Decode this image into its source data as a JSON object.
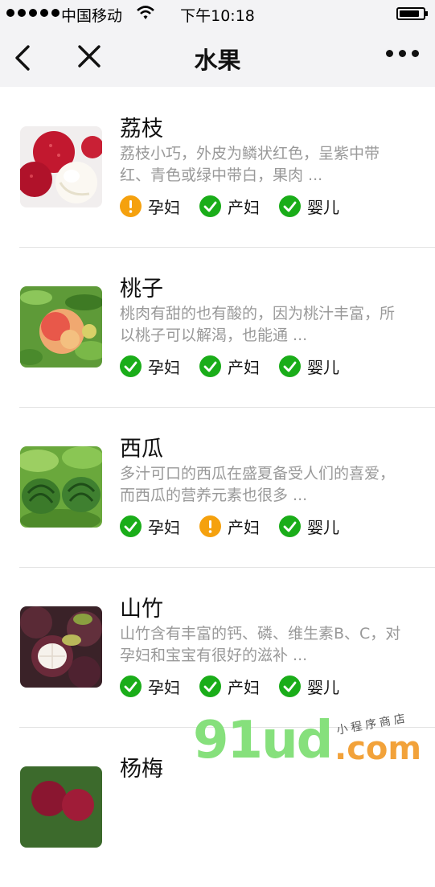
{
  "status_bar": {
    "carrier": "中国移动",
    "time": "下午10:18"
  },
  "nav": {
    "title": "水果",
    "back_icon": "chevron-left-icon",
    "close_icon": "close-icon",
    "more_icon": "more-icon"
  },
  "colors": {
    "ok": "#1aad19",
    "warn": "#f5a10e",
    "description": "#999999"
  },
  "items": [
    {
      "name": "荔枝",
      "description": "荔枝小巧，外皮为鳞状红色，呈紫中带红、青色或绿中带白，果肉 ...",
      "tags": [
        {
          "label": "孕妇",
          "status": "warn"
        },
        {
          "label": "产妇",
          "status": "ok"
        },
        {
          "label": "婴儿",
          "status": "ok"
        }
      ]
    },
    {
      "name": "桃子",
      "description": "桃肉有甜的也有酸的，因为桃汁丰富，所以桃子可以解渴，也能通 ...",
      "tags": [
        {
          "label": "孕妇",
          "status": "ok"
        },
        {
          "label": "产妇",
          "status": "ok"
        },
        {
          "label": "婴儿",
          "status": "ok"
        }
      ]
    },
    {
      "name": "西瓜",
      "description": "多汁可口的西瓜在盛夏备受人们的喜爱，而西瓜的营养元素也很多 ...",
      "tags": [
        {
          "label": "孕妇",
          "status": "ok"
        },
        {
          "label": "产妇",
          "status": "warn"
        },
        {
          "label": "婴儿",
          "status": "ok"
        }
      ]
    },
    {
      "name": "山竹",
      "description": "山竹含有丰富的钙、磷、维生素B、C，对孕妇和宝宝有很好的滋补 ...",
      "tags": [
        {
          "label": "孕妇",
          "status": "ok"
        },
        {
          "label": "产妇",
          "status": "ok"
        },
        {
          "label": "婴儿",
          "status": "ok"
        }
      ]
    },
    {
      "name": "杨梅"
    }
  ],
  "watermark": {
    "main": "91ud",
    "dot": ".com",
    "sub": "小程序商店"
  }
}
